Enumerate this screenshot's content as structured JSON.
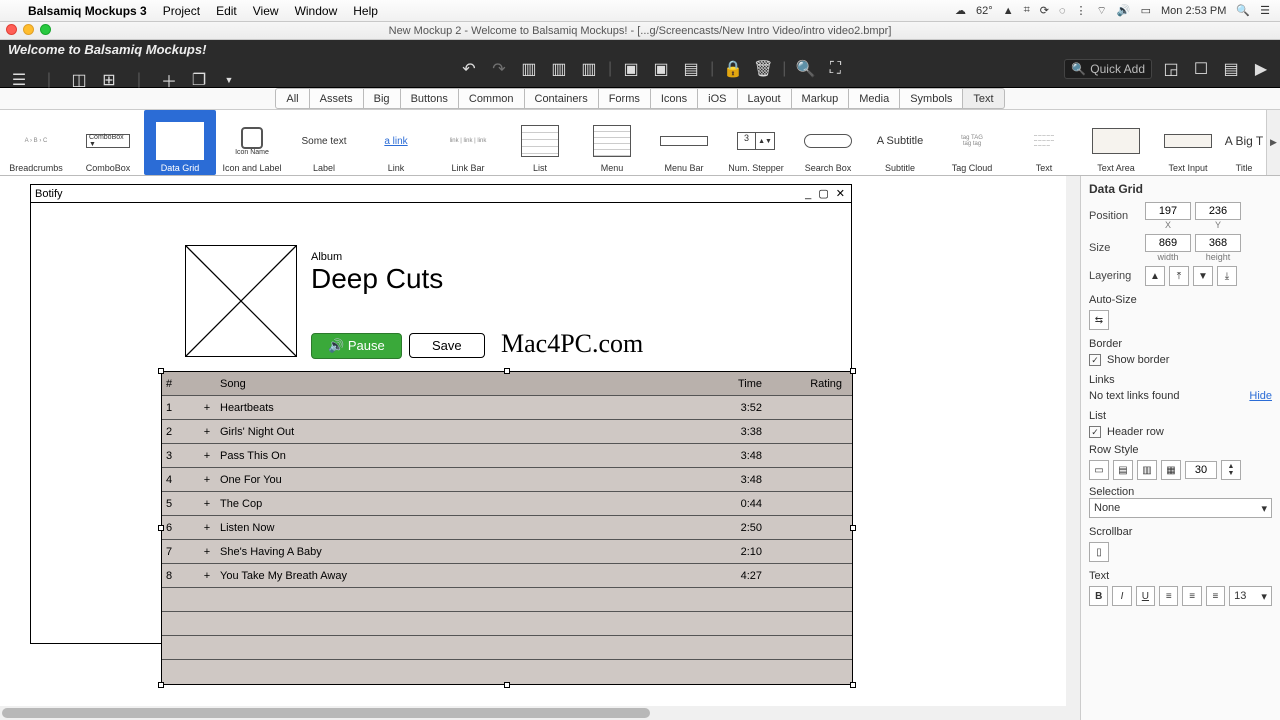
{
  "mac_menu": {
    "app": "Balsamiq Mockups 3",
    "items": [
      "Project",
      "Edit",
      "View",
      "Window",
      "Help"
    ],
    "right": {
      "temp": "62°",
      "day_time": "Mon 2:53 PM"
    }
  },
  "doc_title": "New Mockup 2 - Welcome to Balsamiq Mockups! - [...g/Screencasts/New Intro Video/intro video2.bmpr]",
  "welcome_title": "Welcome to Balsamiq Mockups!",
  "quick_add_placeholder": "Quick Add",
  "filter_tabs": [
    "All",
    "Assets",
    "Big",
    "Buttons",
    "Common",
    "Containers",
    "Forms",
    "Icons",
    "iOS",
    "Layout",
    "Markup",
    "Media",
    "Symbols",
    "Text"
  ],
  "library": [
    {
      "name": "Breadcrumbs"
    },
    {
      "name": "ComboBox"
    },
    {
      "name": "Data Grid",
      "selected": true
    },
    {
      "name": "Icon and Label"
    },
    {
      "name": "Label"
    },
    {
      "name": "Link"
    },
    {
      "name": "Link Bar"
    },
    {
      "name": "List"
    },
    {
      "name": "Menu"
    },
    {
      "name": "Menu Bar"
    },
    {
      "name": "Num. Stepper"
    },
    {
      "name": "Search Box"
    },
    {
      "name": "Subtitle"
    },
    {
      "name": "Tag Cloud"
    },
    {
      "name": "Text"
    },
    {
      "name": "Text Area"
    },
    {
      "name": "Text Input"
    },
    {
      "name": "Title"
    }
  ],
  "library_previews": {
    "combo": "ComboBox ▼",
    "icon_label": "Icon Name",
    "label": "Some text",
    "link": "a link",
    "stepper_num": "3",
    "subtitle": "A Subtitle",
    "title": "A Big T"
  },
  "mock": {
    "window_title": "Botify",
    "album_label": "Album",
    "album_title": "Deep Cuts",
    "pause_label": "Pause",
    "save_label": "Save",
    "watermark": "Mac4PC.com",
    "grid": {
      "headers": {
        "num": "#",
        "song": "Song",
        "time": "Time",
        "rating": "Rating"
      },
      "rows": [
        {
          "n": "1",
          "plus": "+",
          "song": "Heartbeats",
          "time": "3:52"
        },
        {
          "n": "2",
          "plus": "+",
          "song": "Girls' Night Out",
          "time": "3:38"
        },
        {
          "n": "3",
          "plus": "+",
          "song": "Pass This On",
          "time": "3:48"
        },
        {
          "n": "4",
          "plus": "+",
          "song": "One For You",
          "time": "3:48"
        },
        {
          "n": "5",
          "plus": "+",
          "song": "The Cop",
          "time": "0:44"
        },
        {
          "n": "6",
          "plus": "+",
          "song": "Listen Now",
          "time": "2:50"
        },
        {
          "n": "7",
          "plus": "+",
          "song": "She's Having A Baby",
          "time": "2:10"
        },
        {
          "n": "8",
          "plus": "+",
          "song": "You Take My Breath Away",
          "time": "4:27"
        }
      ]
    }
  },
  "inspector": {
    "title": "Data Grid",
    "position_label": "Position",
    "pos_x": "197",
    "pos_y": "236",
    "x_label": "X",
    "y_label": "Y",
    "size_label": "Size",
    "width": "869",
    "height": "368",
    "w_label": "width",
    "h_label": "height",
    "layering_label": "Layering",
    "autosize_label": "Auto-Size",
    "border_label": "Border",
    "show_border": "Show border",
    "links_label": "Links",
    "links_none": "No text links found",
    "links_hide": "Hide",
    "list_label": "List",
    "header_row": "Header row",
    "row_style_label": "Row Style",
    "row_height": "30",
    "selection_label": "Selection",
    "selection_value": "None",
    "scrollbar_label": "Scrollbar",
    "text_label": "Text",
    "font_size": "13"
  }
}
